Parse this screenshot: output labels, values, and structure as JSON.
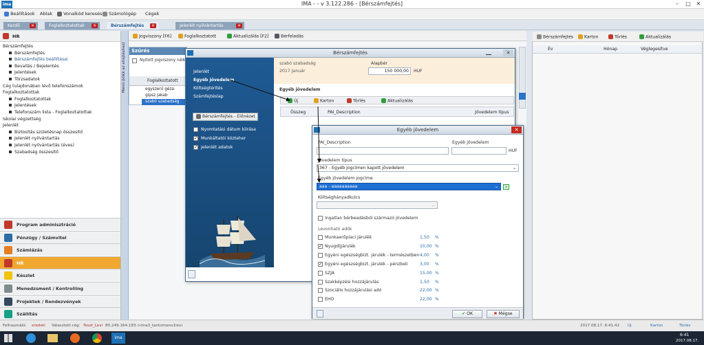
{
  "app": {
    "title": "IMA -  - v 3.122.286 - [Bérszámfejtés]",
    "logo": "ima"
  },
  "menu": {
    "items": [
      "Beállítások",
      "Ablak",
      "Vonalkód keresés",
      "Számológép",
      "Cégek"
    ]
  },
  "tabs": [
    {
      "label": "Kezdő"
    },
    {
      "label": "Foglalkoztatottak"
    },
    {
      "label": "Bérszámfejtés"
    },
    {
      "label": "Jelenlét nyilvántartás"
    }
  ],
  "sidebar": {
    "header": "HR",
    "tree": [
      {
        "label": "Bérszámfejtés",
        "level": 0
      },
      {
        "label": "Bérszámfejtés",
        "level": 1
      },
      {
        "label": "Bérszámfejtés beállításai",
        "level": 1
      },
      {
        "label": "Bevallás / Bejelentés",
        "level": 1
      },
      {
        "label": "Jelentések",
        "level": 1
      },
      {
        "label": "Törzsadatok",
        "level": 1
      },
      {
        "label": "Cég tulajdonában lévő telefonszámok",
        "level": 0
      },
      {
        "label": "Foglalkoztatottak",
        "level": 0
      },
      {
        "label": "Foglalkoztatottak",
        "level": 1
      },
      {
        "label": "Jelentések",
        "level": 1
      },
      {
        "label": "Telefonszám lista - Foglalkoztatottak",
        "level": 1
      },
      {
        "label": "Iskolai végzettség",
        "level": 0
      },
      {
        "label": "Jelenlét",
        "level": 0
      },
      {
        "label": "Biztosítás születésnap összesítő",
        "level": 1
      },
      {
        "label": "Jelenlét nyilvántartás",
        "level": 1
      },
      {
        "label": "Jelenlét nyilvántartás (éves)",
        "level": 1
      },
      {
        "label": "Szabadság összesítő",
        "level": 1
      }
    ],
    "modules": [
      {
        "label": "Program adminisztráció",
        "color": "#c0392b"
      },
      {
        "label": "Pénzügy / Számvitel",
        "color": "#2e6da4"
      },
      {
        "label": "Számlázás",
        "color": "#e67e22"
      },
      {
        "label": "HR",
        "color": "#c0392b",
        "active": true
      },
      {
        "label": "Készlet",
        "color": "#f1c40f"
      },
      {
        "label": "Menedzsment / Kontrolling",
        "color": "#7f8c8d"
      },
      {
        "label": "Projektek / Rendezvények",
        "color": "#34495e"
      },
      {
        "label": "Szállítás",
        "color": "#16a085"
      }
    ],
    "strip_label": "Menü (klikk az elrejtéshez)"
  },
  "work": {
    "toolbar": [
      "Jogviszony [F6]",
      "Foglalkoztatott",
      "Aktualizálás [F2]",
      "Bérfeladás"
    ],
    "filter_title": "Szűrés",
    "filter_check": "Nyitott jogviszony nélk.",
    "list_header": "Foglalkoztatott",
    "employees": [
      "egyszerű géza",
      "gipsz jakab",
      "szabó szabadság"
    ],
    "selected_employee": "szabó szabadság"
  },
  "berdlg": {
    "title": "Bérszámfejtés",
    "nav": [
      "Jelenlét",
      "Egyéb jövedelem",
      "Költségtérítés",
      "Számfejtéslap"
    ],
    "nav_active": "Egyéb jövedelem",
    "preview_btn": "Bérszámfejtés - Előnézet",
    "checks": [
      {
        "label": "Nyomtatási dátum kiírása",
        "checked": false
      },
      {
        "label": "Munkáltatói közteher",
        "checked": true
      },
      {
        "label": "Jelenlét adatok",
        "checked": true
      }
    ],
    "employee_name": "szabó szabadság",
    "period": "2017 Január",
    "alapber_label": "Alapbér",
    "alapber_value": "150 000,00",
    "currency": "HUF",
    "section_title": "Egyéb jövedelem",
    "toolbar": [
      "Új",
      "Karton",
      "Törlés",
      "Aktualizálás"
    ],
    "columns": [
      "Összeg",
      "PAI_Description",
      "Jövedelem típus"
    ]
  },
  "egyeb": {
    "title": "Egyéb jövedelem",
    "pai_label": "PAI_Description",
    "pai_value": "",
    "ej_label": "Egyéb jövedelem",
    "ej_value": "",
    "currency": "HUF",
    "tipus_label": "Jövedelem típus",
    "tipus_value": "367 - Egyéb jogcímen kapott jövedelem",
    "jogcim_label": "Egyéb jövedelem jogcíme",
    "jogcim_value": "aaa - aaaaaaaaaa",
    "koltseg_label": "Költséghányadkulcs",
    "koltseg_value": "",
    "ingatlan": "Ingatlan bérbeadásból származó jövedelem",
    "levonhato": "Levonható adók",
    "taxes": [
      {
        "label": "Munkaerőpiaci járulék",
        "value": "1,50",
        "checked": false
      },
      {
        "label": "Nyugdíjjárulék",
        "value": "10,00",
        "checked": true
      },
      {
        "label": "Egyéni egészségbizt. járulék - természetben",
        "value": "4,00",
        "checked": false
      },
      {
        "label": "Egyéni egészségbizt. járulék - pénzbeli",
        "value": "3,00",
        "checked": true
      },
      {
        "label": "SZJA",
        "value": "15,00",
        "checked": false
      },
      {
        "label": "Szakképzési hozzájárulás",
        "value": "1,50",
        "checked": false
      },
      {
        "label": "Szociális hozzájárulási adó",
        "value": "22,00",
        "checked": false
      },
      {
        "label": "EHO",
        "value": "22,00",
        "checked": false
      }
    ],
    "percent": "%",
    "ok": "OK",
    "cancel": "Mégse"
  },
  "right": {
    "toolbar": [
      "Bérszámfejtés",
      "Karton",
      "Törlés",
      "Aktualizálás"
    ],
    "columns": [
      "Év",
      "Hónap",
      "Véglegesítve"
    ]
  },
  "status": {
    "user_label": "Felhasználó:",
    "user": "eredeti",
    "company_label": "Választott cég:",
    "company": "Teszt_Levi",
    "server": "80.249.164.183->ima3_tantomeno1levi",
    "timestamp": "2017.08.17. 6:41:42",
    "uj": "Új",
    "karton": "Karton",
    "torles": "Törlés"
  },
  "taskbar": {
    "time": "6:41",
    "date": "2017.08.17."
  }
}
